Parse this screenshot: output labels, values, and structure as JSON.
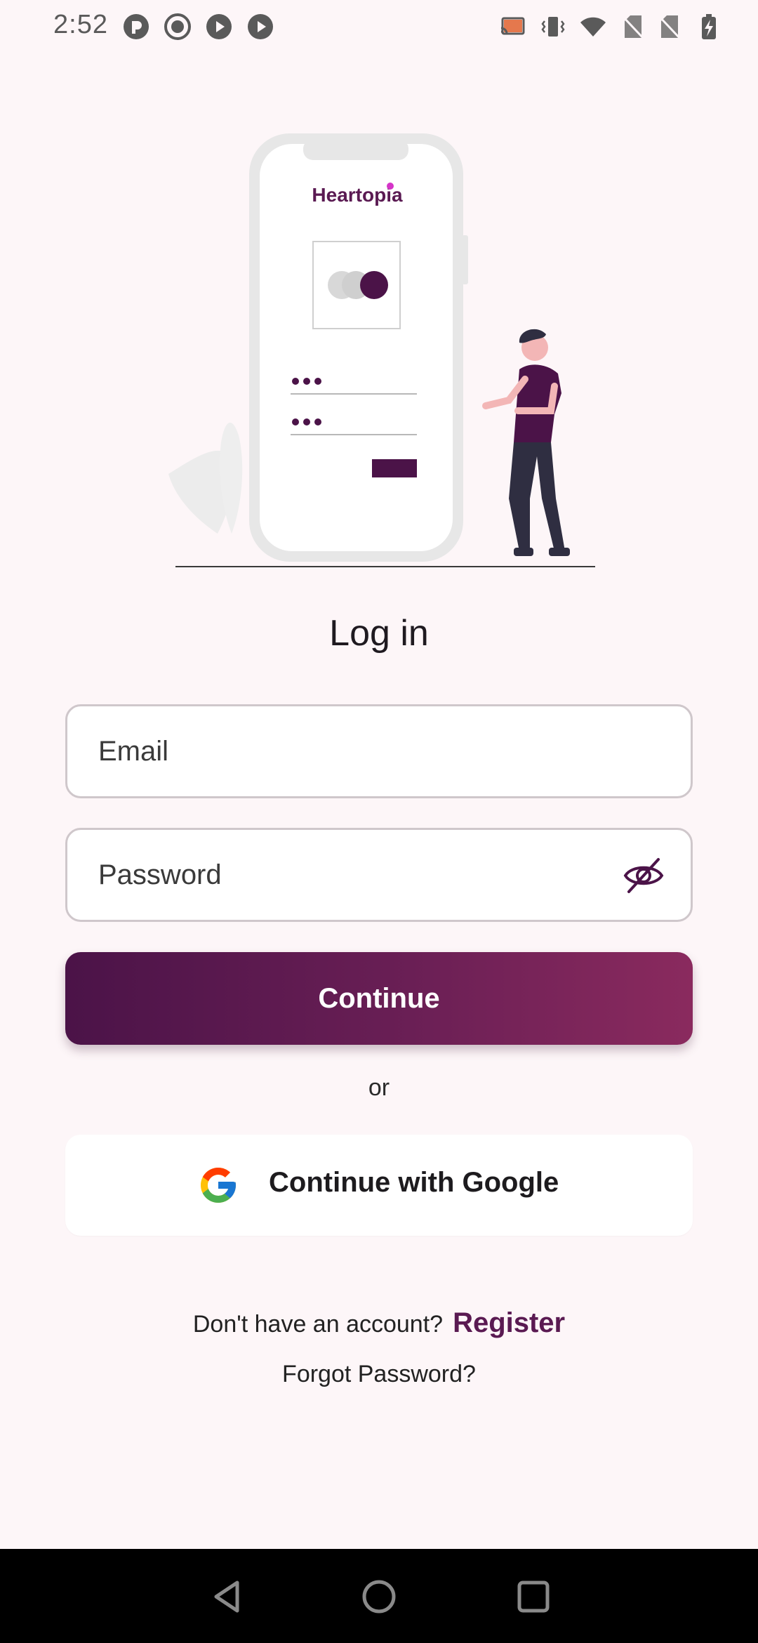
{
  "status_bar": {
    "time": "2:52",
    "left_icons": [
      "pocket-casts-icon",
      "record-icon",
      "play-icon",
      "play-icon"
    ],
    "right_icons": [
      "cast-icon",
      "vibrate-icon",
      "wifi-icon",
      "no-sim-icon",
      "no-sim-icon",
      "battery-charging-icon"
    ]
  },
  "illustration": {
    "brand_name": "Heartopia"
  },
  "login": {
    "title": "Log in",
    "email_placeholder": "Email",
    "password_placeholder": "Password",
    "continue_label": "Continue",
    "or_label": "or",
    "google_label": "Continue with Google",
    "no_account_text": "Don't have an account?",
    "register_label": "Register",
    "forgot_label": "Forgot Password?"
  },
  "nav_bar": {
    "buttons": [
      "back-icon",
      "home-icon",
      "recents-icon"
    ]
  },
  "colors": {
    "background": "#fdf6f8",
    "brand_primary": "#4b1348",
    "brand_secondary": "#8a2a5e",
    "register_link": "#5a1a52"
  }
}
